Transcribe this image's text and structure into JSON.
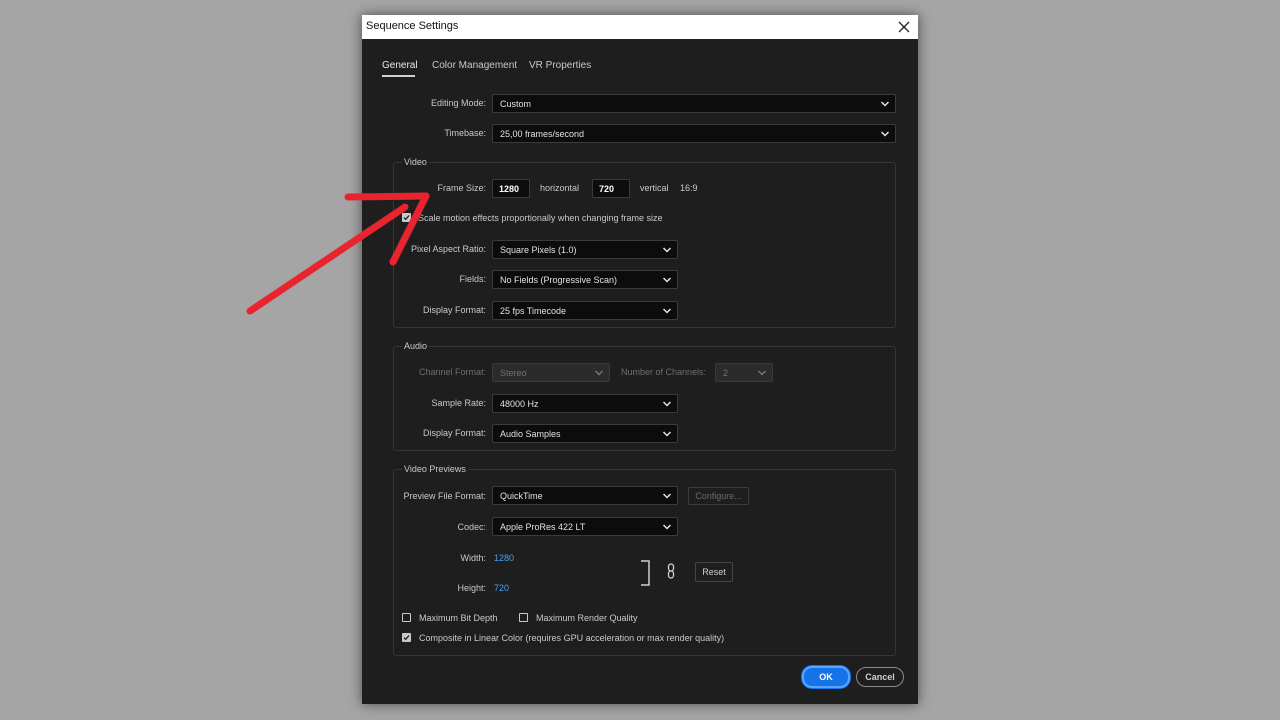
{
  "dialog": {
    "title": "Sequence Settings",
    "tabs": [
      {
        "label": "General",
        "active": true
      },
      {
        "label": "Color Management",
        "active": false
      },
      {
        "label": "VR Properties",
        "active": false
      }
    ]
  },
  "general": {
    "editing_mode": {
      "label": "Editing Mode:",
      "value": "Custom"
    },
    "timebase": {
      "label": "Timebase:",
      "value": "25,00  frames/second"
    }
  },
  "video": {
    "title": "Video",
    "frame_size_label": "Frame Size:",
    "horizontal_value": "1280",
    "horizontal_label": "horizontal",
    "vertical_value": "720",
    "vertical_label": "vertical",
    "aspect": "16:9",
    "scale_motion": {
      "label": "Scale motion effects proportionally when changing frame size",
      "checked": true
    },
    "pixel_aspect_ratio": {
      "label": "Pixel Aspect Ratio:",
      "value": "Square Pixels (1.0)"
    },
    "fields": {
      "label": "Fields:",
      "value": "No Fields (Progressive Scan)"
    },
    "display_format": {
      "label": "Display Format:",
      "value": "25 fps Timecode"
    }
  },
  "audio": {
    "title": "Audio",
    "channel_format": {
      "label": "Channel Format:",
      "value": "Stereo",
      "disabled": true
    },
    "number_of_channels": {
      "label": "Number of Channels:",
      "value": "2",
      "disabled": true
    },
    "sample_rate": {
      "label": "Sample Rate:",
      "value": "48000 Hz"
    },
    "display_format": {
      "label": "Display Format:",
      "value": "Audio Samples"
    }
  },
  "video_previews": {
    "title": "Video Previews",
    "preview_file_format": {
      "label": "Preview File Format:",
      "value": "QuickTime"
    },
    "configure_label": "Configure...",
    "codec": {
      "label": "Codec:",
      "value": "Apple ProRes 422 LT"
    },
    "width": {
      "label": "Width:",
      "value": "1280"
    },
    "height": {
      "label": "Height:",
      "value": "720"
    },
    "reset_label": "Reset",
    "max_bit_depth": {
      "label": "Maximum Bit Depth",
      "checked": false
    },
    "max_render_quality": {
      "label": "Maximum Render Quality",
      "checked": false
    },
    "composite_linear": {
      "label": "Composite in Linear Color (requires GPU acceleration or max render quality)",
      "checked": true
    }
  },
  "buttons": {
    "ok": "OK",
    "cancel": "Cancel"
  },
  "annotation": {
    "arrow_color": "#e8242e"
  },
  "colors": {
    "accent": "#1473e6",
    "link_value": "#4a9fff",
    "background": "#a5a5a5",
    "dialog_bg": "#1e1e1e"
  }
}
